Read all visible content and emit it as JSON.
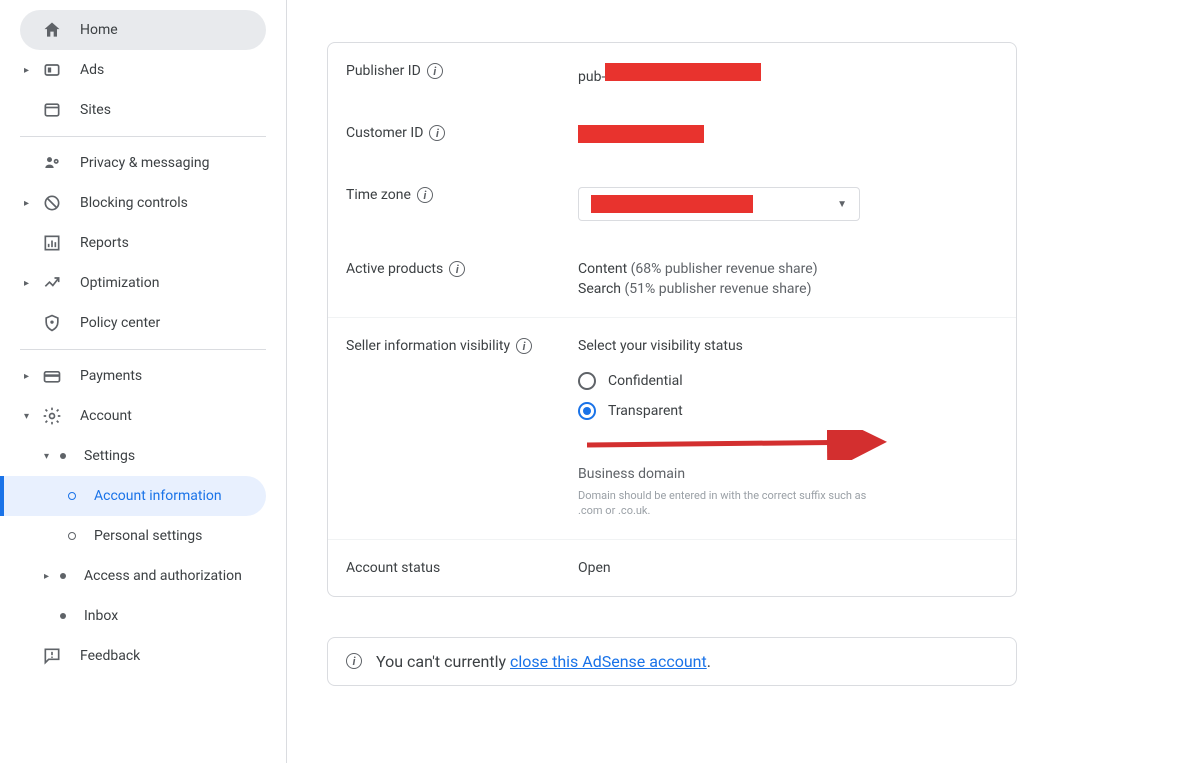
{
  "sidebar": {
    "home": "Home",
    "ads": "Ads",
    "sites": "Sites",
    "privacy": "Privacy & messaging",
    "blocking": "Blocking controls",
    "reports": "Reports",
    "optimization": "Optimization",
    "policy": "Policy center",
    "payments": "Payments",
    "account": "Account",
    "settings": "Settings",
    "account_info": "Account information",
    "personal": "Personal settings",
    "access": "Access and authorization",
    "inbox": "Inbox",
    "feedback": "Feedback"
  },
  "account": {
    "publisher_id": {
      "label": "Publisher ID",
      "prefix": "pub-"
    },
    "customer_id": {
      "label": "Customer ID"
    },
    "timezone": {
      "label": "Time zone"
    },
    "active_products": {
      "label": "Active products",
      "line1": "Content",
      "line1_share": " (68% publisher revenue share)",
      "line2": "Search",
      "line2_share": " (51% publisher revenue share)"
    },
    "seller_visibility": {
      "label": "Seller information visibility",
      "instruction": "Select your visibility status",
      "options": {
        "confidential": "Confidential",
        "transparent": "Transparent"
      },
      "domain_label": "Business domain",
      "domain_hint": "Domain should be entered in with the correct suffix such as .com or .co.uk."
    },
    "status": {
      "label": "Account status",
      "value": "Open"
    }
  },
  "notice": {
    "prefix": "You can't currently ",
    "link": "close this AdSense account",
    "suffix": "."
  }
}
